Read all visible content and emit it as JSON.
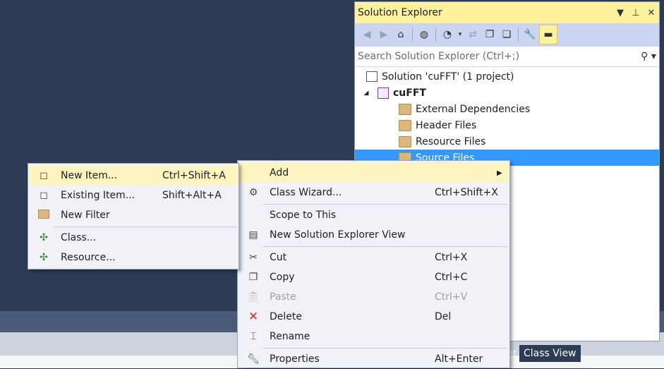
{
  "solution_explorer": {
    "title": "Solution Explorer",
    "title_buttons": [
      "▼",
      "⊥",
      "✕"
    ],
    "search_placeholder": "Search Solution Explorer (Ctrl+;)",
    "tree": [
      {
        "label": "Solution 'cuFFT' (1 project)",
        "icon": "solution-icon"
      },
      {
        "label": "cuFFT",
        "icon": "project-icon",
        "expanded": true
      },
      {
        "label": "External Dependencies",
        "icon": "folder-icon"
      },
      {
        "label": "Header Files",
        "icon": "folder-icon"
      },
      {
        "label": "Resource Files",
        "icon": "folder-icon"
      },
      {
        "label": "Source Files",
        "icon": "folder-icon",
        "selected": true
      }
    ],
    "bottom_tabs": [
      "er",
      "Class View"
    ]
  },
  "context_menu": {
    "items": [
      {
        "label": "Add",
        "shortcut": "",
        "icon": "",
        "submenu": true,
        "highlighted": true
      },
      {
        "label": "Class Wizard...",
        "shortcut": "Ctrl+Shift+X",
        "icon": "class-wizard-icon"
      },
      {
        "label": "Scope to This",
        "shortcut": "",
        "icon": ""
      },
      {
        "label": "New Solution Explorer View",
        "shortcut": "",
        "icon": "new-view-icon"
      },
      {
        "label": "Cut",
        "shortcut": "Ctrl+X",
        "icon": "scissors-icon"
      },
      {
        "label": "Copy",
        "shortcut": "Ctrl+C",
        "icon": "copy-icon"
      },
      {
        "label": "Paste",
        "shortcut": "Ctrl+V",
        "icon": "paste-icon",
        "disabled": true
      },
      {
        "label": "Delete",
        "shortcut": "Del",
        "icon": "delete-icon"
      },
      {
        "label": "Rename",
        "shortcut": "",
        "icon": "rename-icon"
      },
      {
        "label": "Properties",
        "shortcut": "Alt+Enter",
        "icon": "wrench-icon"
      }
    ]
  },
  "add_submenu": {
    "items": [
      {
        "label": "New Item...",
        "shortcut": "Ctrl+Shift+A",
        "icon": "new-item-icon",
        "highlighted": true
      },
      {
        "label": "Existing Item...",
        "shortcut": "Shift+Alt+A",
        "icon": "existing-item-icon"
      },
      {
        "label": "New Filter",
        "shortcut": "",
        "icon": "new-filter-icon"
      },
      {
        "label": "Class...",
        "shortcut": "",
        "icon": "class-icon"
      },
      {
        "label": "Resource...",
        "shortcut": "",
        "icon": "resource-icon"
      }
    ]
  },
  "colors": {
    "accent_title": "#fff29d",
    "selection": "#3399ff",
    "background": "#2d3b55"
  }
}
